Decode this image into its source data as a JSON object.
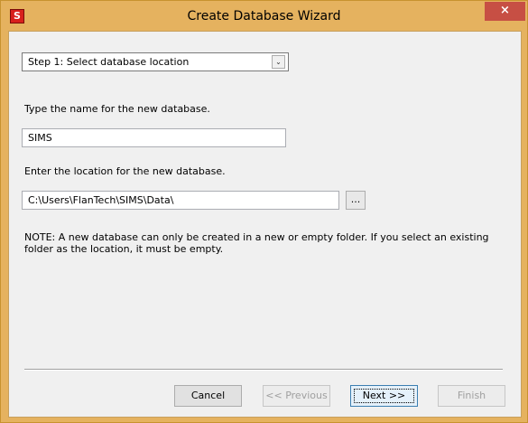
{
  "window": {
    "title": "Create Database Wizard",
    "app_icon_letter": "S",
    "close_glyph": "×"
  },
  "step_selector": {
    "selected": "Step 1: Select database location",
    "arrow": "⌄"
  },
  "name_section": {
    "label": "Type the name for the new database.",
    "value": "SIMS"
  },
  "location_section": {
    "label": "Enter the location for the new database.",
    "value": "C:\\Users\\FlanTech\\SIMS\\Data\\",
    "browse_label": "..."
  },
  "note": "NOTE: A new database can only be created in a new or empty folder.  If you select an existing folder as the location, it must be empty.",
  "buttons": {
    "cancel": "Cancel",
    "previous": "<< Previous",
    "next": "Next >>",
    "finish": "Finish"
  },
  "colors": {
    "frame": "#e5b25f",
    "close": "#c74f44",
    "app_icon": "#d8201c"
  }
}
